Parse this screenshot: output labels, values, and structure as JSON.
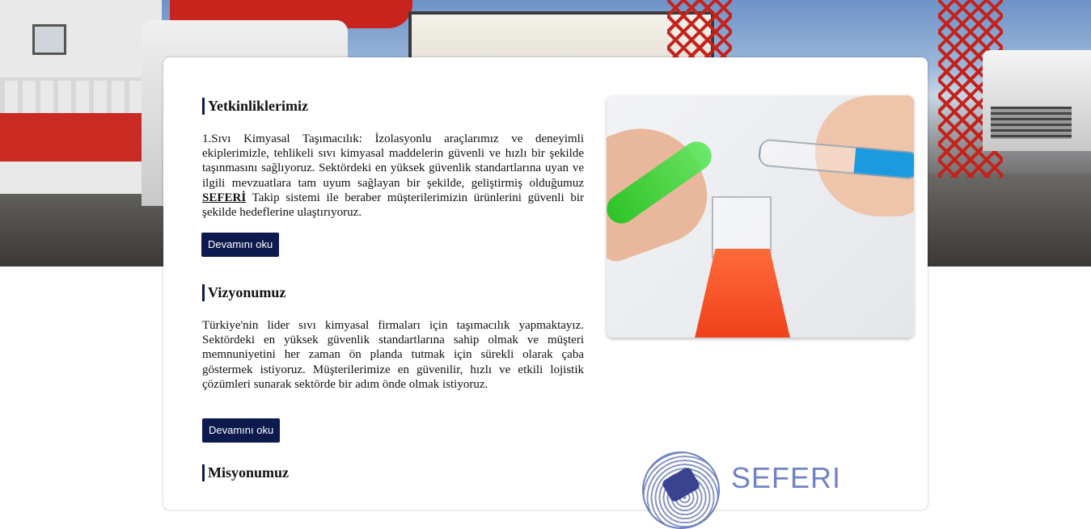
{
  "sections": [
    {
      "title": "Yetkinliklerimiz",
      "text_part1": "1.Sıvı Kimyasal Taşımacılık: İzolasyonlu araçlarımız ve deneyimli ekiplerimizle, tehlikeli sıvı kimyasal maddelerin güvenli ve hızlı bir şekilde taşınmasını sağlıyoruz. Sektördeki en yüksek güvenlik standartlarına uyan ve ilgili mevzuatlara tam uyum sağlayan bir şekilde, geliştirmiş olduğumuz ",
      "brand": "SEFERİ",
      "text_part2": " Takip sistemi ile beraber müşterilerimizin ürünlerini güvenli bir şekilde hedeflerine ulaştırıyoruz.",
      "button": "Devamını oku"
    },
    {
      "title": "Vizyonumuz",
      "text": "Türkiye'nin lider sıvı kimyasal firmaları için taşımacılık yapmaktayız. Sektördeki en yüksek güvenlik standartlarına sahip olmak ve müşteri memnuniyetini her zaman ön planda tutmak için sürekli olarak çaba göstermek istiyoruz. Müşterilerimize en güvenilir, hızlı ve etkili lojistik çözümleri sunarak sektörde bir adım önde olmak istiyoruz.",
      "button": "Devamını oku"
    },
    {
      "title": "Misyonumuz"
    }
  ],
  "logo": {
    "word": "SEFERI"
  },
  "colors": {
    "primary": "#0d1a4d",
    "logo_blue": "#7083c4"
  },
  "images": {
    "hero": "industrial-port-trucks-photo",
    "lab": "lab-chemicals-photo"
  }
}
